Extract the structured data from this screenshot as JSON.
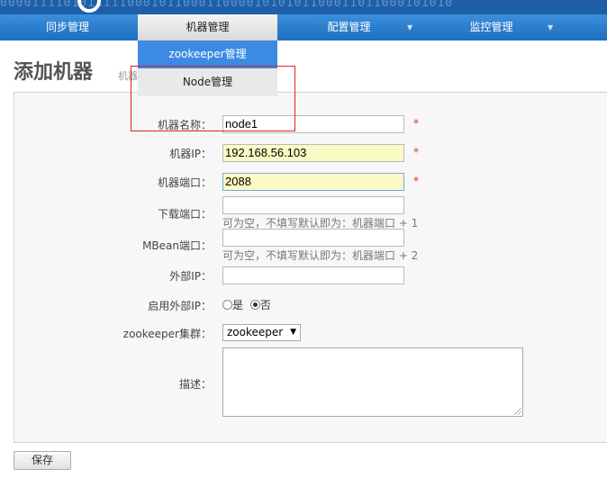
{
  "banner": {
    "digits": "000011110101111100010110001100001010101100011011000101010"
  },
  "nav": {
    "items": [
      {
        "label": "同步管理"
      },
      {
        "label": "机器管理"
      },
      {
        "label": "配置管理",
        "caret": "▼"
      },
      {
        "label": "监控管理",
        "caret": "▼"
      }
    ]
  },
  "dropdown": {
    "items": [
      {
        "label": "zookeeper管理"
      },
      {
        "label": "Node管理"
      }
    ]
  },
  "page": {
    "title": "添加机器",
    "breadcrumb": "机器"
  },
  "form": {
    "name_label": "机器名称：",
    "name_value": "node1",
    "ip_label": "机器IP：",
    "ip_value": "192.168.56.103",
    "port_label": "机器端口：",
    "port_value": "2088",
    "download_port_label": "下载端口：",
    "download_port_value": "",
    "download_port_hint": "可为空，不填写默认即为：机器端口 + 1",
    "mbean_port_label": "MBean端口：",
    "mbean_port_value": "",
    "mbean_port_hint": "可为空，不填写默认即为：机器端口 + 2",
    "external_ip_label": "外部IP：",
    "external_ip_value": "",
    "use_external_ip_label": "启用外部IP：",
    "radio_yes": "是",
    "radio_no": "否",
    "zk_cluster_label": "zookeeper集群：",
    "zk_cluster_value": "zookeeper",
    "description_label": "描述：",
    "required_mark": "*"
  },
  "actions": {
    "save_label": "保存"
  },
  "colors": {
    "nav_blue": "#2a7fd0",
    "dropdown_active": "#3c8ae3",
    "required": "#e03030",
    "highlight_border": "#e02020",
    "input_yellow": "#fafbc4"
  }
}
